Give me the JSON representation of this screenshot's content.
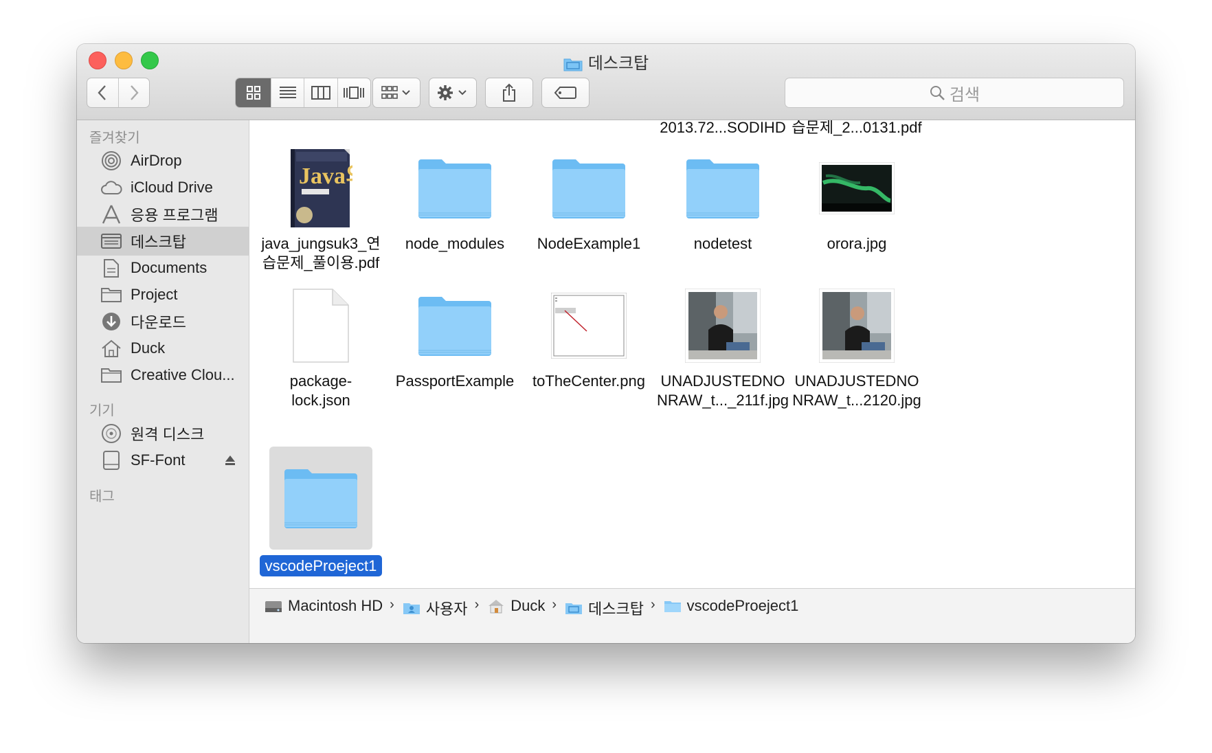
{
  "window": {
    "title": "데스크탑"
  },
  "toolbar": {
    "back_icon": "chevron-left-icon",
    "forward_icon": "chevron-right-icon",
    "view_modes": [
      "icon-view",
      "list-view",
      "column-view",
      "coverflow-view"
    ],
    "arrange_icon": "group-icon",
    "action_icon": "gear-icon",
    "share_icon": "share-icon",
    "tag_icon": "tag-icon",
    "search_placeholder": "검색"
  },
  "sidebar": {
    "favorites_header": "즐겨찾기",
    "favorites": [
      {
        "label": "AirDrop",
        "icon": "airdrop-icon"
      },
      {
        "label": "iCloud Drive",
        "icon": "cloud-icon"
      },
      {
        "label": "응용 프로그램",
        "icon": "applications-icon"
      },
      {
        "label": "데스크탑",
        "icon": "desktop-icon",
        "selected": true
      },
      {
        "label": "Documents",
        "icon": "document-icon"
      },
      {
        "label": "Project",
        "icon": "folder-icon"
      },
      {
        "label": "다운로드",
        "icon": "download-icon"
      },
      {
        "label": "Duck",
        "icon": "home-icon"
      },
      {
        "label": "Creative Clou...",
        "icon": "folder-icon"
      }
    ],
    "devices_header": "기기",
    "devices": [
      {
        "label": "원격 디스크",
        "icon": "disc-icon"
      },
      {
        "label": "SF-Font",
        "icon": "drive-icon",
        "eject": true
      }
    ],
    "tags_header": "태그"
  },
  "content": {
    "partial_labels": [
      "2013.72...SODIHD",
      "습문제_2...0131.pdf"
    ],
    "files": [
      {
        "label": "java_jungsuk3_연습문제_풀이용.pdf",
        "label_lines": [
          "java_jungsuk3_연",
          "습문제_풀이용.pdf"
        ],
        "kind": "pdf-book",
        "book_title": "Java의 정석"
      },
      {
        "label_lines": [
          "node_modules"
        ],
        "kind": "folder"
      },
      {
        "label_lines": [
          "NodeExample1"
        ],
        "kind": "folder"
      },
      {
        "label_lines": [
          "nodetest"
        ],
        "kind": "folder"
      },
      {
        "label_lines": [
          "orora.jpg"
        ],
        "kind": "aurora-image"
      },
      {
        "label_lines": [
          "package-",
          "lock.json"
        ],
        "kind": "blank-doc"
      },
      {
        "label_lines": [
          "PassportExample"
        ],
        "kind": "folder"
      },
      {
        "label_lines": [
          "toTheCenter.png"
        ],
        "kind": "png-sketch"
      },
      {
        "label_lines": [
          "UNADJUSTEDNO",
          "NRAW_t..._211f.jpg"
        ],
        "kind": "photo"
      },
      {
        "label_lines": [
          "UNADJUSTEDNO",
          "NRAW_t...2120.jpg"
        ],
        "kind": "photo"
      },
      {
        "label_lines": [
          "vscodeProeject1"
        ],
        "kind": "folder",
        "selected": true
      }
    ]
  },
  "pathbar": {
    "crumbs": [
      {
        "label": "Macintosh HD",
        "icon": "hard-drive-icon"
      },
      {
        "label": "사용자",
        "icon": "users-folder-icon"
      },
      {
        "label": "Duck",
        "icon": "home-icon"
      },
      {
        "label": "데스크탑",
        "icon": "desktop-folder-icon"
      },
      {
        "label": "vscodeProeject1",
        "icon": "folder-icon"
      }
    ]
  },
  "colors": {
    "selection": "#1f66d6",
    "folder": "#8fcdf8",
    "sidebar_bg": "#e8e8e8"
  }
}
